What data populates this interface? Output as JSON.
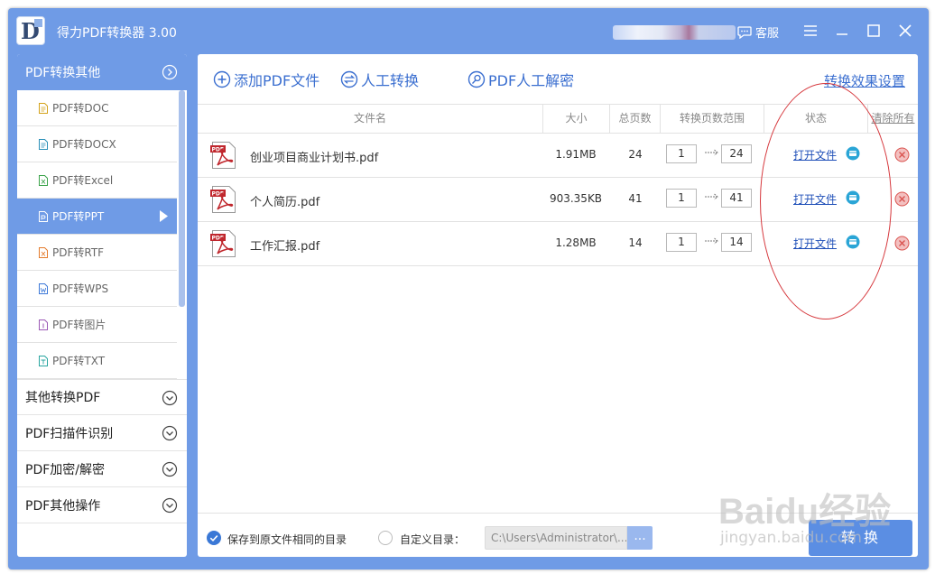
{
  "app": {
    "title": "得力PDF转换器 3.00",
    "service_label": "客服"
  },
  "sidebar": {
    "groups": [
      {
        "label": "PDF转换其他",
        "expanded": true
      },
      {
        "label": "其他转换PDF",
        "expanded": false
      },
      {
        "label": "PDF扫描件识别",
        "expanded": false
      },
      {
        "label": "PDF加密/解密",
        "expanded": false
      },
      {
        "label": "PDF其他操作",
        "expanded": false
      }
    ],
    "items": [
      {
        "label": "PDF转DOC",
        "icon": "doc-file-icon",
        "color": "#d4a21a",
        "active": false
      },
      {
        "label": "PDF转DOCX",
        "icon": "docx-file-icon",
        "color": "#2a8fb8",
        "active": false
      },
      {
        "label": "PDF转Excel",
        "icon": "excel-file-icon",
        "color": "#3aa34a",
        "active": false
      },
      {
        "label": "PDF转PPT",
        "icon": "ppt-file-icon",
        "color": "#ffffff",
        "active": true
      },
      {
        "label": "PDF转RTF",
        "icon": "rtf-file-icon",
        "color": "#e47b2b",
        "active": false
      },
      {
        "label": "PDF转WPS",
        "icon": "wps-file-icon",
        "color": "#3c78d8",
        "active": false
      },
      {
        "label": "PDF转图片",
        "icon": "image-file-icon",
        "color": "#9b59b6",
        "active": false
      },
      {
        "label": "PDF转TXT",
        "icon": "txt-file-icon",
        "color": "#2aa6a1",
        "active": false
      }
    ]
  },
  "toolbar": {
    "add_file": "添加PDF文件",
    "manual_convert": "人工转换",
    "manual_decrypt": "PDF人工解密",
    "settings": "转换效果设置"
  },
  "table": {
    "headers": {
      "name": "文件名",
      "size": "大小",
      "pages": "总页数",
      "range": "转换页数范围",
      "status": "状态",
      "clear_all": "清除所有"
    },
    "rows": [
      {
        "name": "创业项目商业计划书.pdf",
        "size": "1.91MB",
        "pages": "24",
        "from": "1",
        "to": "24",
        "status": "打开文件"
      },
      {
        "name": "个人简历.pdf",
        "size": "903.35KB",
        "pages": "41",
        "from": "1",
        "to": "41",
        "status": "打开文件"
      },
      {
        "name": "工作汇报.pdf",
        "size": "1.28MB",
        "pages": "14",
        "from": "1",
        "to": "14",
        "status": "打开文件"
      }
    ]
  },
  "output": {
    "same_dir_label": "保存到原文件相同的目录",
    "same_dir_selected": true,
    "custom_dir_label": "自定义目录：",
    "custom_dir_value": "C:\\Users\\Administrator\\...",
    "browse_label": "...",
    "convert_label": "转 换"
  },
  "watermark": {
    "main": "Baidu经验",
    "sub": "jingyan.baidu.com"
  },
  "colors": {
    "accent": "#6f9be6",
    "link": "#3b6fd0",
    "annotation": "#d6383d"
  }
}
